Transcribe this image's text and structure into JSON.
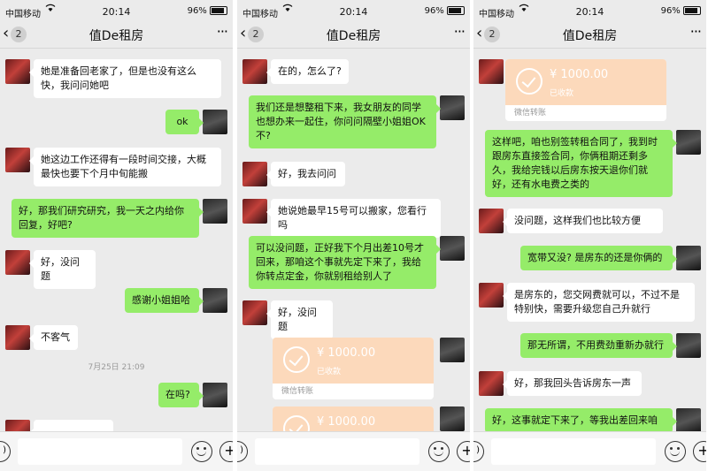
{
  "panels": [
    {
      "status": {
        "carrier": "中国移动",
        "time": "20:14",
        "battery": "96%"
      },
      "nav": {
        "count": "2",
        "title": "值De租房",
        "more": "···",
        "back": "‹"
      },
      "messages": [
        {
          "side": "left",
          "text": "她是准备回老家了，但是也没有这么快，我问问她吧"
        },
        {
          "side": "right",
          "text": "ok"
        },
        {
          "side": "left",
          "text": "她这边工作还得有一段时间交接，大概最快也要下个月中旬能搬"
        },
        {
          "side": "right",
          "text": "好，那我们研究研究，我一天之内给你回复，好吧?"
        },
        {
          "side": "left",
          "text": "好，没问题"
        },
        {
          "side": "right",
          "text": "感谢小姐姐哈"
        },
        {
          "side": "left",
          "text": "不客气"
        },
        {
          "type": "time",
          "text": "7月25日 21:09"
        },
        {
          "side": "right",
          "text": "在吗?"
        }
      ]
    },
    {
      "status": {
        "carrier": "中国移动",
        "time": "20:14",
        "battery": "96%"
      },
      "nav": {
        "count": "2",
        "title": "值De租房",
        "more": "···",
        "back": "‹"
      },
      "messages": [
        {
          "side": "left",
          "text": "在的，怎么了?"
        },
        {
          "side": "right",
          "text": "我们还是想整租下来，我女朋友的同学也想办来一起住，你问问隔壁小姐姐OK不?"
        },
        {
          "side": "left",
          "text": "好，我去问问"
        },
        {
          "side": "left",
          "text": "她说她最早15号可以搬家，您看行吗"
        },
        {
          "side": "right",
          "text": "可以没问题，正好我下个月出差10号才回来，那咱这个事就先定下来了，我给你转点定金，你就别租给别人了"
        },
        {
          "side": "left",
          "text": "好，没问题"
        },
        {
          "type": "transfer",
          "side": "left",
          "amount": "¥ 1000.00",
          "state": "已收款",
          "label": "微信转账"
        },
        {
          "type": "transfer",
          "side": "left",
          "amount": "¥ 1000.00",
          "state": "",
          "label": ""
        }
      ]
    },
    {
      "status": {
        "carrier": "中国移动",
        "time": "20:14",
        "battery": "96%"
      },
      "nav": {
        "count": "2",
        "title": "值De租房",
        "more": "···",
        "back": "‹"
      },
      "messages": [
        {
          "type": "transfer",
          "side": "left",
          "amount": "¥ 1000.00",
          "state": "已收款",
          "label": "微信转账"
        },
        {
          "side": "right",
          "text": "这样吧，咱也别签转租合同了，我到时跟房东直接签合同，你俩租期还剩多久，我给完钱以后房东按天退你们就好，还有水电费之类的"
        },
        {
          "side": "left",
          "text": "没问题，这样我们也比较方便"
        },
        {
          "side": "right",
          "text": "宽带又没? 是房东的还是你俩的"
        },
        {
          "side": "left",
          "text": "是房东的，您交网费就可以，不过不是特别快，需要升级您自己升就行"
        },
        {
          "side": "right",
          "text": "那无所谓，不用费劲重新办就行"
        },
        {
          "side": "left",
          "text": "好，那我回头告诉房东一声"
        },
        {
          "side": "right",
          "text": "好，这事就定下来了，等我出差回来咱"
        }
      ]
    }
  ],
  "colors": {
    "green_bubble": "#95ec69",
    "white_bubble": "#ffffff",
    "transfer": "#fcd9bb",
    "background": "#ebebeb"
  }
}
